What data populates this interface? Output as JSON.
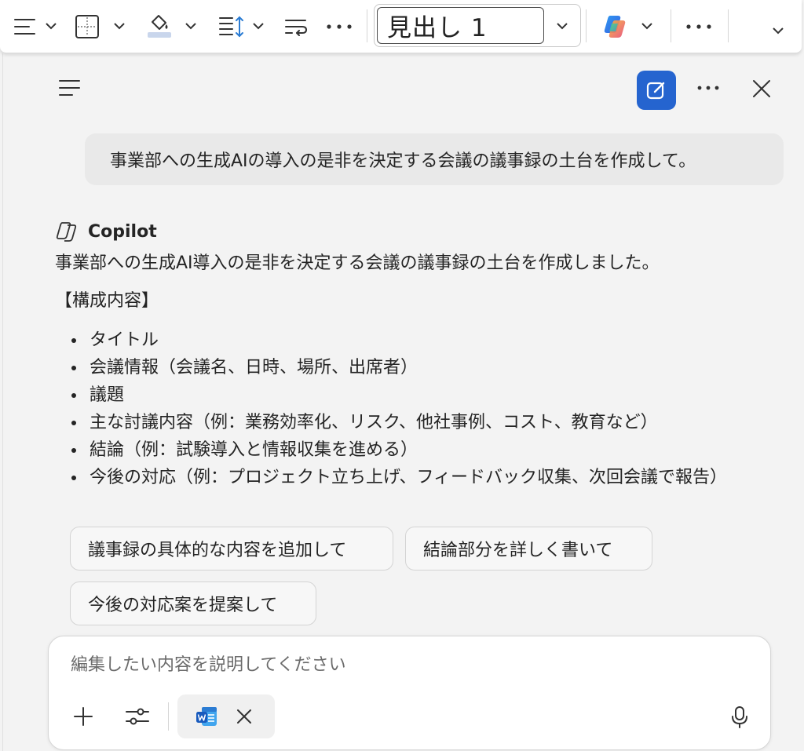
{
  "ribbon": {
    "style_value": "見出し 1"
  },
  "user_message": "事業部への生成AIの導入の是非を決定する会議の議事録の土台を作成して。",
  "copilot": {
    "name": "Copilot",
    "response_intro": "事業部への生成AI導入の是非を決定する会議の議事録の土台を作成しました。",
    "section_title": "【構成内容】",
    "items": [
      "タイトル",
      "会議情報（会議名、日時、場所、出席者）",
      "議題",
      "主な討議内容（例：業務効率化、リスク、他社事例、コスト、教育など）",
      "結論（例：試験導入と情報収集を進める）",
      "今後の対応（例：プロジェクト立ち上げ、フィードバック収集、次回会議で報告）"
    ]
  },
  "suggestions": [
    "議事録の具体的な内容を追加して",
    "結論部分を詳しく書いて",
    "今後の対応案を提案して"
  ],
  "composer": {
    "placeholder": "編集したい内容を説明してください"
  },
  "colors": {
    "accent": "#2564cf",
    "pane_bg": "#f3f3f3",
    "user_bubble": "#e9e9e9"
  }
}
